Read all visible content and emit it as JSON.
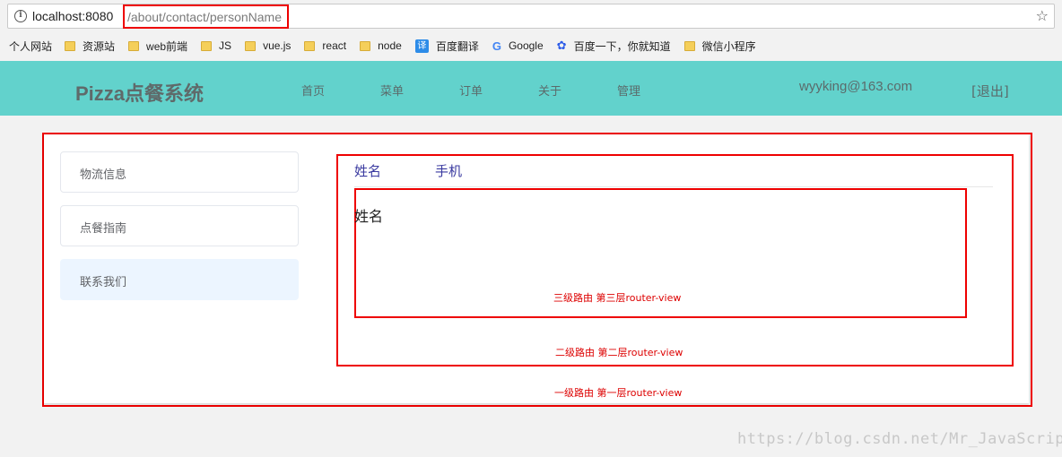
{
  "browser": {
    "url_host": "localhost:8080",
    "url_path": "/about/contact/personName",
    "bookmarks": [
      {
        "label": "个人网站",
        "icon": "none"
      },
      {
        "label": "资源站",
        "icon": "folder-icon"
      },
      {
        "label": "web前端",
        "icon": "folder-icon"
      },
      {
        "label": "JS",
        "icon": "folder-icon"
      },
      {
        "label": "vue.js",
        "icon": "folder-icon"
      },
      {
        "label": "react",
        "icon": "folder-icon"
      },
      {
        "label": "node",
        "icon": "folder-icon"
      },
      {
        "label": "百度翻译",
        "icon": "translate-icon",
        "badge": "译"
      },
      {
        "label": "Google",
        "icon": "google-icon",
        "badge": "G"
      },
      {
        "label": "百度一下，你就知道",
        "icon": "baidu-paw-icon",
        "badge": "✿"
      },
      {
        "label": "微信小程序",
        "icon": "folder-icon"
      }
    ]
  },
  "header": {
    "brand": "Pizza点餐系统",
    "nav": [
      "首页",
      "菜单",
      "订单",
      "关于",
      "管理"
    ],
    "user_email": "wyyking@163.com",
    "logout": "[退出]",
    "bg_color": "#62d2cc"
  },
  "sidebar": {
    "items": [
      {
        "label": "物流信息",
        "active": false
      },
      {
        "label": "点餐指南",
        "active": false
      },
      {
        "label": "联系我们",
        "active": true
      }
    ]
  },
  "contact": {
    "tabs": [
      "姓名",
      "手机"
    ],
    "content": "姓名"
  },
  "annotations": {
    "level1": "一级路由 第一层router-view",
    "level2": "二级路由 第二层router-view",
    "level3": "三级路由 第三层router-view",
    "box_color": "#e00000"
  },
  "watermark": "https://blog.csdn.net/Mr_JavaScript"
}
